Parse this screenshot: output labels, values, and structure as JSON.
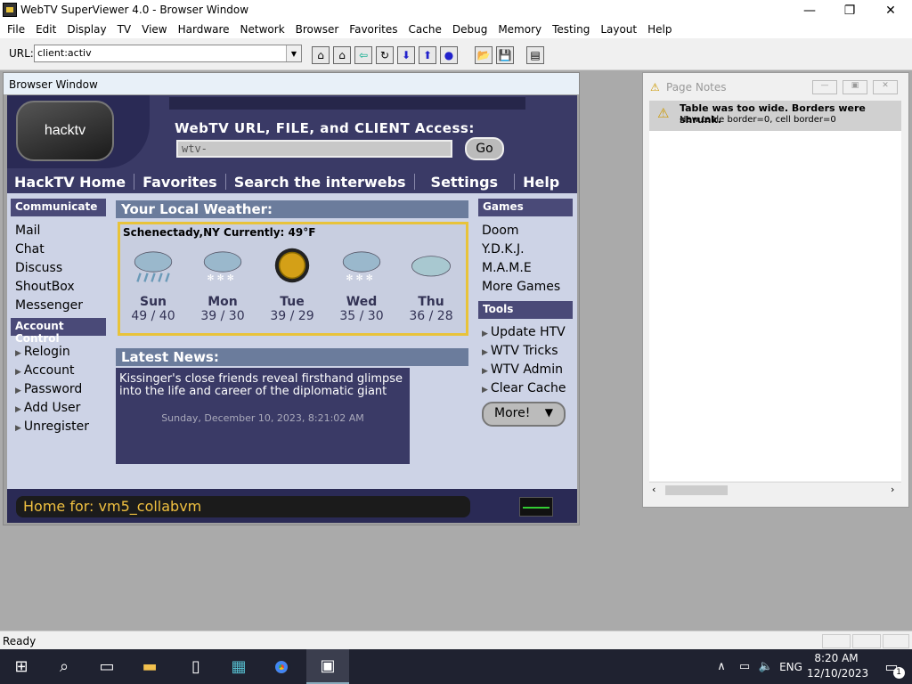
{
  "window": {
    "title": "WebTV SuperViewer 4.0 - Browser Window",
    "minimize": "—",
    "maximize": "❐",
    "close": "✕"
  },
  "menu": [
    "File",
    "Edit",
    "Display",
    "TV",
    "View",
    "Hardware",
    "Network",
    "Browser",
    "Favorites",
    "Cache",
    "Debug",
    "Memory",
    "Testing",
    "Layout",
    "Help"
  ],
  "toolbar": {
    "url_label": "URL:",
    "url_value": "client:activ",
    "buttons": [
      "home-network-icon",
      "home-icon",
      "back-icon",
      "reload-icon",
      "down-icon",
      "up-icon",
      "stop-icon",
      "open-icon",
      "save-icon",
      "page-icon"
    ]
  },
  "browser": {
    "title": "Browser Window",
    "logo": "hacktv",
    "heading": "WebTV URL, FILE, and CLIENT Access:",
    "input_value": "wtv-",
    "go": "Go",
    "nav": [
      "HackTV Home",
      "Favorites",
      "Search the interwebs",
      "Settings",
      "Help"
    ],
    "communicate": {
      "title": "Communicate",
      "items": [
        "Mail",
        "Chat",
        "Discuss",
        "ShoutBox",
        "Messenger"
      ]
    },
    "account": {
      "title": "Account Control",
      "items": [
        "Relogin",
        "Account",
        "Password",
        "Add User",
        "Unregister"
      ]
    },
    "weather": {
      "title": "Your Local Weather:",
      "location": "Schenectady,NY  Currently:  49°F",
      "days": [
        {
          "day": "Sun",
          "temp": "49 / 40",
          "icon": "rain-cloud-icon"
        },
        {
          "day": "Mon",
          "temp": "39 / 30",
          "icon": "snow-cloud-icon"
        },
        {
          "day": "Tue",
          "temp": "39 / 29",
          "icon": "sun-icon"
        },
        {
          "day": "Wed",
          "temp": "35 / 30",
          "icon": "snow-cloud-icon"
        },
        {
          "day": "Thu",
          "temp": "36 / 28",
          "icon": "cloud-icon"
        }
      ]
    },
    "news": {
      "title": "Latest News:",
      "headline": "Kissinger's close friends reveal firsthand glimpse into the life and career of the diplomatic giant",
      "date": "Sunday, December 10, 2023, 8:21:02 AM"
    },
    "games": {
      "title": "Games",
      "items": [
        "Doom",
        "Y.D.K.J.",
        "M.A.M.E",
        "More Games"
      ]
    },
    "tools": {
      "title": "Tools",
      "items": [
        "Update HTV",
        "WTV Tricks",
        "WTV Admin",
        "Clear Cache"
      ],
      "more": "More!"
    },
    "home_for": "Home for: vm5_collabvm"
  },
  "notes": {
    "title": "Page Notes",
    "msg_title": "Table was too wide. Borders were shrunk.",
    "msg_detail": "New table border=0, cell border=0"
  },
  "status": {
    "text": "Ready"
  },
  "taskbar": {
    "lang": "ENG",
    "time": "8:20 AM",
    "date": "12/10/2023",
    "notif_count": "1"
  }
}
